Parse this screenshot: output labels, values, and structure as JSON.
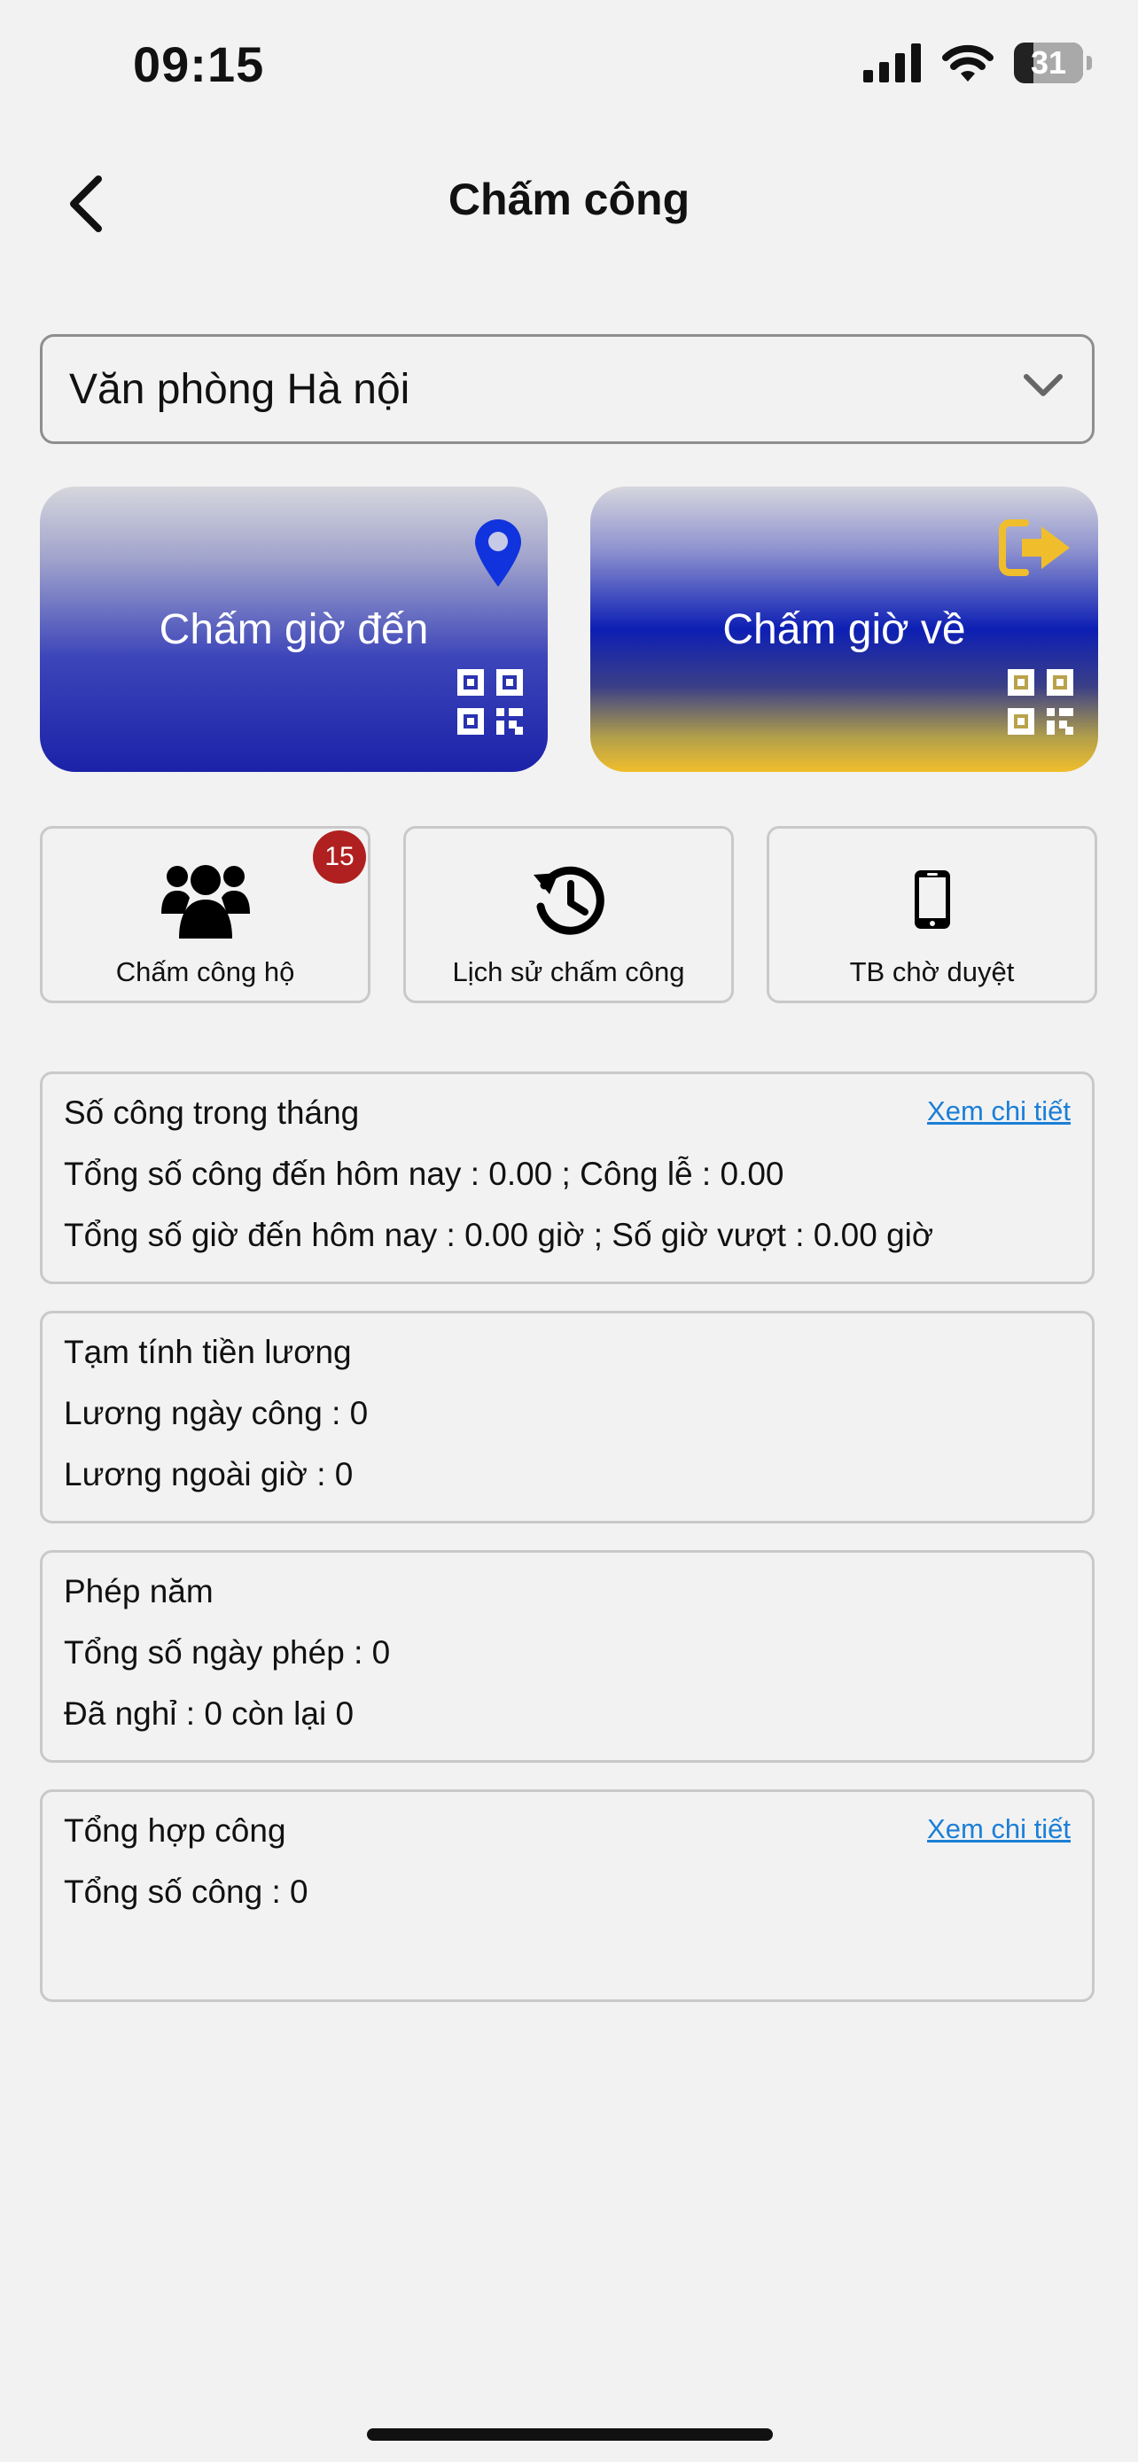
{
  "status_bar": {
    "time": "09:15",
    "battery": "31"
  },
  "header": {
    "title": "Chấm công"
  },
  "office_select": {
    "value": "Văn phòng Hà nội"
  },
  "checkin": {
    "label": "Chấm giờ đến"
  },
  "checkout": {
    "label": "Chấm giờ về"
  },
  "actions": [
    {
      "label": "Chấm công hộ",
      "badge": "15",
      "icon": "users-icon"
    },
    {
      "label": "Lịch sử chấm công",
      "icon": "history-icon"
    },
    {
      "label": "TB chờ duyệt",
      "icon": "phone-icon"
    }
  ],
  "cards": {
    "monthly": {
      "title": "Số công trong tháng",
      "link": "Xem chi tiết",
      "line1": "Tổng số công đến hôm nay : 0.00 ; Công lễ : 0.00",
      "line2": "Tổng số giờ đến hôm nay :  0.00 giờ ; Số giờ vượt :  0.00 giờ"
    },
    "salary": {
      "title": "Tạm tính tiền lương",
      "line1": "Lương ngày công : 0",
      "line2": "Lương ngoài giờ : 0"
    },
    "leave": {
      "title": "Phép năm",
      "line1": "Tổng số ngày phép : 0",
      "line2": "Đã nghỉ : 0 còn lại 0"
    },
    "summary": {
      "title": "Tổng hợp công",
      "link": "Xem chi tiết",
      "line1": "Tổng số công : 0"
    }
  },
  "colors": {
    "accent_blue": "#1c22a8",
    "accent_yellow": "#f0be2c",
    "link": "#1b7fd6",
    "badge": "#b02020"
  }
}
